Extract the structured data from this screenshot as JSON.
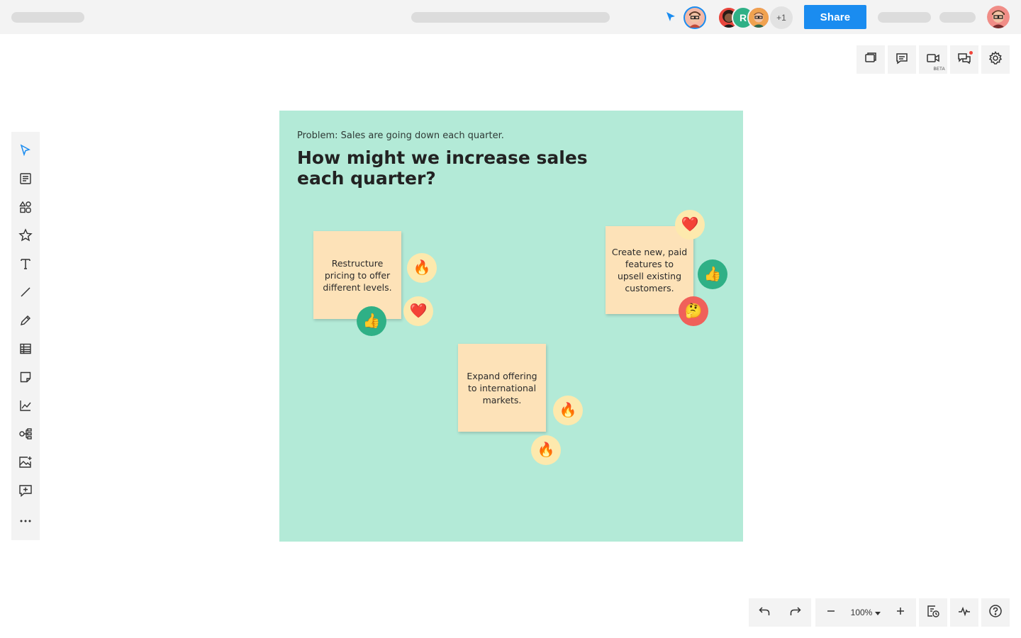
{
  "topbar": {
    "collaborators_more": "+1",
    "avatar_initial": "R",
    "share_label": "Share"
  },
  "board": {
    "subtitle": "Problem: Sales are going down each quarter.",
    "title": "How might we increase sales each quarter?",
    "stickies": [
      {
        "text": "Restructure pricing to offer different levels.",
        "reactions": [
          "fire",
          "heart",
          "thumbs-up"
        ]
      },
      {
        "text": "Create new, paid features to upsell existing customers.",
        "reactions": [
          "heart",
          "thumbs-up",
          "thinking"
        ]
      },
      {
        "text": "Expand offering to international markets.",
        "reactions": [
          "fire",
          "fire"
        ]
      }
    ]
  },
  "right_toolbar": {
    "video_badge": "BETA"
  },
  "bottom_toolbar": {
    "zoom_level": "100%"
  },
  "colors": {
    "board_background": "#b3ead7",
    "sticky_note": "#fde2b8",
    "share_button": "#1a8cf0",
    "accent_cursor": "#1a8cf0"
  },
  "left_toolbar_icons": [
    "select-icon",
    "document-icon",
    "shapes-icon",
    "star-icon",
    "text-icon",
    "line-icon",
    "pen-icon",
    "table-icon",
    "sticky-note-icon",
    "chart-icon",
    "mind-map-icon",
    "image-icon",
    "comment-add-icon",
    "more-icon"
  ]
}
